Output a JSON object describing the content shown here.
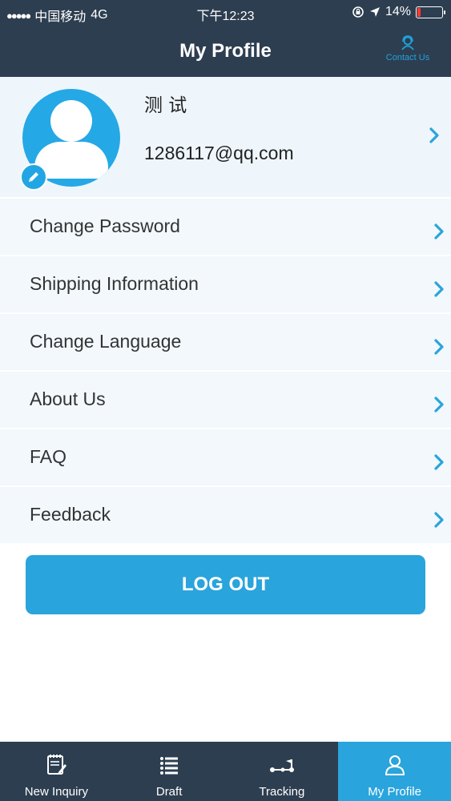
{
  "status_bar": {
    "signal": "●●●●●",
    "carrier": "中国移动",
    "network": "4G",
    "time": "下午12:23",
    "battery_text": "14%",
    "battery_level": 0.14,
    "battery_color": "#ff3b30"
  },
  "header": {
    "title": "My Profile",
    "contact_label": "Contact Us",
    "contact_icon": "headset-icon"
  },
  "profile": {
    "name": "测 试",
    "email": "1286117@qq.com",
    "avatar_icon": "user-avatar-icon",
    "edit_icon": "pencil-icon"
  },
  "menu": {
    "items": [
      {
        "label": "Change Password"
      },
      {
        "label": "Shipping Information"
      },
      {
        "label": "Change Language"
      },
      {
        "label": "About Us"
      },
      {
        "label": "FAQ"
      },
      {
        "label": "Feedback"
      }
    ]
  },
  "logout_label": "LOG OUT",
  "tabs": [
    {
      "label": "New Inquiry",
      "icon": "notepad-icon",
      "active": false
    },
    {
      "label": "Draft",
      "icon": "list-icon",
      "active": false
    },
    {
      "label": "Tracking",
      "icon": "route-icon",
      "active": false
    },
    {
      "label": "My Profile",
      "icon": "person-icon",
      "active": true
    }
  ],
  "colors": {
    "header_bg": "#2d3e50",
    "accent": "#2aa4dc",
    "row_bg": "#f2f8fc"
  }
}
